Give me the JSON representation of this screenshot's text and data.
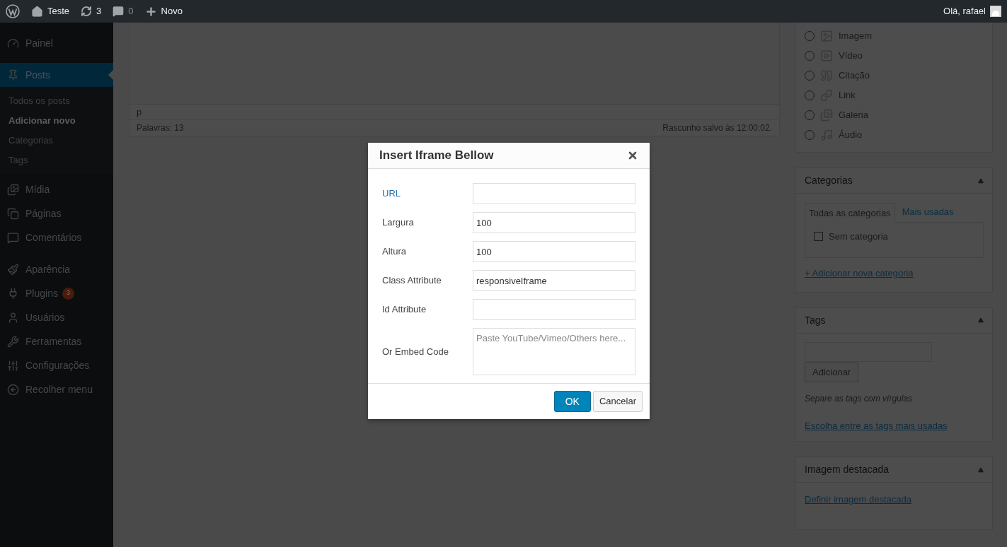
{
  "admin_bar": {
    "site": "Teste",
    "updates": "3",
    "comments": "0",
    "new": "Novo",
    "greeting": "Olá, rafael"
  },
  "sidebar": {
    "items": [
      {
        "label": "Painel",
        "selected": false
      },
      {
        "label": "Posts",
        "selected": true,
        "children": [
          {
            "label": "Todos os posts",
            "selected": false
          },
          {
            "label": "Adicionar novo",
            "selected": true
          },
          {
            "label": "Categorias",
            "selected": false
          },
          {
            "label": "Tags",
            "selected": false
          }
        ]
      },
      {
        "label": "Mídia",
        "selected": false
      },
      {
        "label": "Páginas",
        "selected": false
      },
      {
        "label": "Comentários",
        "selected": false
      },
      {
        "label": "Aparência",
        "selected": false
      },
      {
        "label": "Plugins",
        "selected": false,
        "badge": "3"
      },
      {
        "label": "Usuários",
        "selected": false
      },
      {
        "label": "Ferramentas",
        "selected": false
      },
      {
        "label": "Configurações",
        "selected": false
      },
      {
        "label": "Recolher menu",
        "selected": false
      }
    ]
  },
  "editor": {
    "path": "p",
    "word_count": "Palavras: 13",
    "saved": "Rascunho salvo às 12:00:02."
  },
  "format_box": {
    "options": [
      {
        "label": "Imagem",
        "selected": false
      },
      {
        "label": "Vídeo",
        "selected": false
      },
      {
        "label": "Citação",
        "selected": false
      },
      {
        "label": "Link",
        "selected": false
      },
      {
        "label": "Galeria",
        "selected": false
      },
      {
        "label": "Áudio",
        "selected": false
      }
    ]
  },
  "categories": {
    "title": "Categorias",
    "tabs": [
      {
        "label": "Todas as categorias",
        "selected": true
      },
      {
        "label": "Mais usadas",
        "selected": false
      }
    ],
    "items": [
      {
        "label": "Sem categoria",
        "checked": false
      }
    ],
    "add_link": "+ Adicionar nova categoria"
  },
  "tags": {
    "title": "Tags",
    "button": "Adicionar",
    "hint": "Separe as tags com vírgulas",
    "link": "Escolha entre as tags mais usadas"
  },
  "featured_image": {
    "title": "Imagem destacada",
    "link": "Definir imagem destacada"
  },
  "dialog": {
    "title": "Insert Iframe Bellow",
    "fields": [
      {
        "label": "URL",
        "kind": "input",
        "focused": true
      },
      {
        "label": "Largura",
        "kind": "input",
        "value": "100",
        "focused": false
      },
      {
        "label": "Altura",
        "kind": "input",
        "value": "100",
        "focused": false
      },
      {
        "label": "Class Attribute",
        "kind": "input",
        "value": "responsiveIframe",
        "focused": false
      },
      {
        "label": "Id Attribute",
        "kind": "input",
        "focused": false
      },
      {
        "label": "Or Embed Code",
        "kind": "textarea",
        "placeholder": "Paste YouTube/Vimeo/Others here...",
        "focused": false
      }
    ],
    "ok": "OK",
    "cancel": "Cancelar"
  }
}
